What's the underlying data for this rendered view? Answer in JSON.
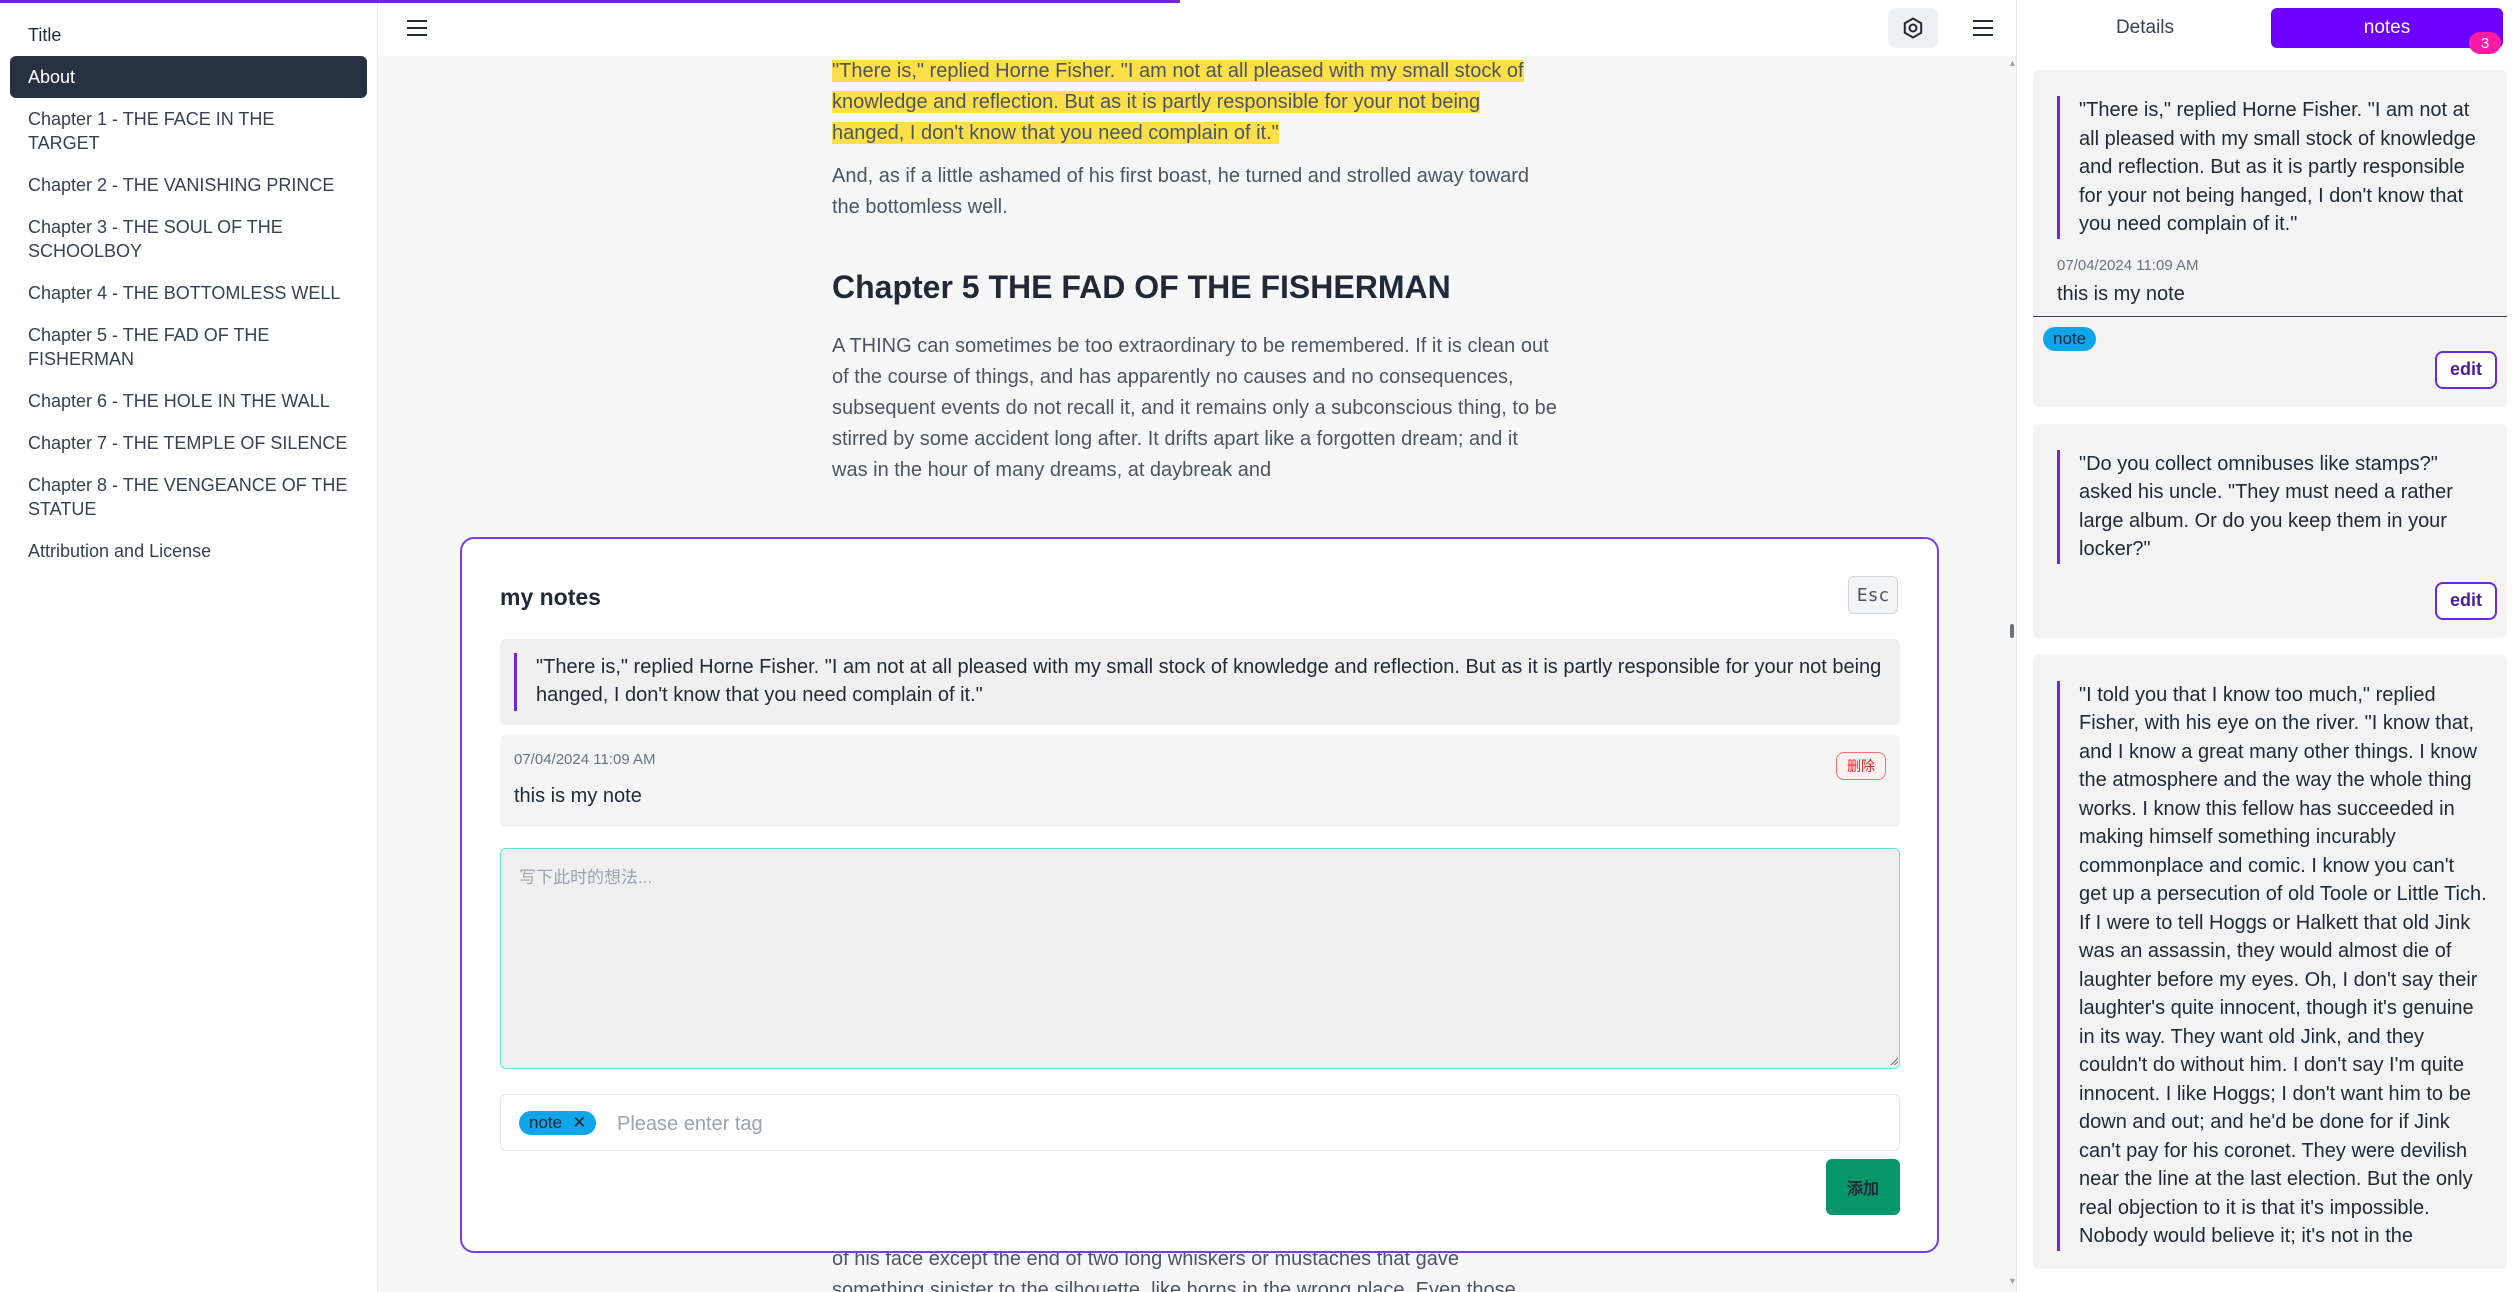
{
  "toc": {
    "items": [
      {
        "label": "Title"
      },
      {
        "label": "About"
      },
      {
        "label": "Chapter 1 - THE FACE IN THE TARGET"
      },
      {
        "label": "Chapter 2 - THE VANISHING PRINCE"
      },
      {
        "label": "Chapter 3 - THE SOUL OF THE SCHOOLBOY"
      },
      {
        "label": "Chapter 4 - THE BOTTOMLESS WELL"
      },
      {
        "label": "Chapter 5 - THE FAD OF THE FISHERMAN"
      },
      {
        "label": "Chapter 6 - THE HOLE IN THE WALL"
      },
      {
        "label": "Chapter 7 - THE TEMPLE OF SILENCE"
      },
      {
        "label": "Chapter 8 - THE VENGEANCE OF THE STATUE"
      },
      {
        "label": "Attribution and License"
      }
    ],
    "active_index": 1
  },
  "reader": {
    "highlighted_paragraph": "\"There is,\" replied Horne Fisher. \"I am not at all pleased with my small stock of knowledge and reflection. But as it is partly responsible for your not being hanged, I don't know that you need complain of it.\"",
    "paragraph_2": "And, as if a little ashamed of his first boast, he turned and strolled away toward the bottomless well.",
    "chapter_heading": "Chapter 5 THE FAD OF THE FISHERMAN",
    "paragraph_3": "A THING can sometimes be too extraordinary to be remembered. If it is clean out of the course of things, and has apparently no causes and no consequences, subsequent events do not recall it, and it remains only a subconscious thing, to be stirred by some accident long after. It drifts apart like a forgotten dream; and it was in the hour of many dreams, at daybreak and",
    "bottom_text_1": "of his face except the end of two long whiskers or mustaches that gave",
    "bottom_text_2": "something sinister to the silhouette, like horns in the wrong place. Even those"
  },
  "icons": {
    "menu_left": "hamburger-icon",
    "settings": "settings-icon",
    "menu_right": "hamburger-icon"
  },
  "modal": {
    "title": "my notes",
    "esc_label": "Esc",
    "quote": "\"There is,\" replied Horne Fisher. \"I am not at all pleased with my small stock of knowledge and reflection. But as it is partly responsible for your not being hanged, I don't know that you need complain of it.\"",
    "note_date": "07/04/2024 11:09 AM",
    "note_text": "this is my note",
    "delete_label": "删除",
    "input_placeholder": "写下此时的想法...",
    "tag_chip": "note",
    "tag_remove": "✕",
    "tag_placeholder": "Please enter tag",
    "add_label": "添加"
  },
  "side": {
    "tab_details": "Details",
    "tab_notes": "notes",
    "notes_count": "3",
    "cards": [
      {
        "quote": "\"There is,\" replied Horne Fisher. \"I am not at all pleased with my small stock of knowledge and reflection. But as it is partly responsible for your not being hanged, I don't know that you need complain of it.\"",
        "date": "07/04/2024 11:09 AM",
        "note": "this is my note",
        "tag": "note",
        "edit_label": "edit"
      },
      {
        "quote": "\"Do you collect omnibuses like stamps?\" asked his uncle. \"They must need a rather large album. Or do you keep them in your locker?\"",
        "edit_label": "edit"
      },
      {
        "quote": "\"I told you that I know too much,\" replied Fisher, with his eye on the river. \"I know that, and I know a great many other things. I know the atmosphere and the way the whole thing works. I know this fellow has succeeded in making himself something incurably commonplace and comic. I know you can't get up a persecution of old Toole or Little Tich. If I were to tell Hoggs or Halkett that old Jink was an assassin, they would almost die of laughter before my eyes. Oh, I don't say their laughter's quite innocent, though it's genuine in its way. They want old Jink, and they couldn't do without him. I don't say I'm quite innocent. I like Hoggs; I don't want him to be down and out; and he'd be done for if Jink can't pay for his coronet. They were devilish near the line at the last election. But the only real objection to it is that it's impossible. Nobody would believe it; it's not in the"
      }
    ]
  },
  "colors": {
    "accent": "#6d28d9",
    "tab_active": "#6d00ff",
    "badge": "#ff1aa3",
    "highlight": "#fde047",
    "tag": "#0ea5e9",
    "add_button": "#059669"
  }
}
